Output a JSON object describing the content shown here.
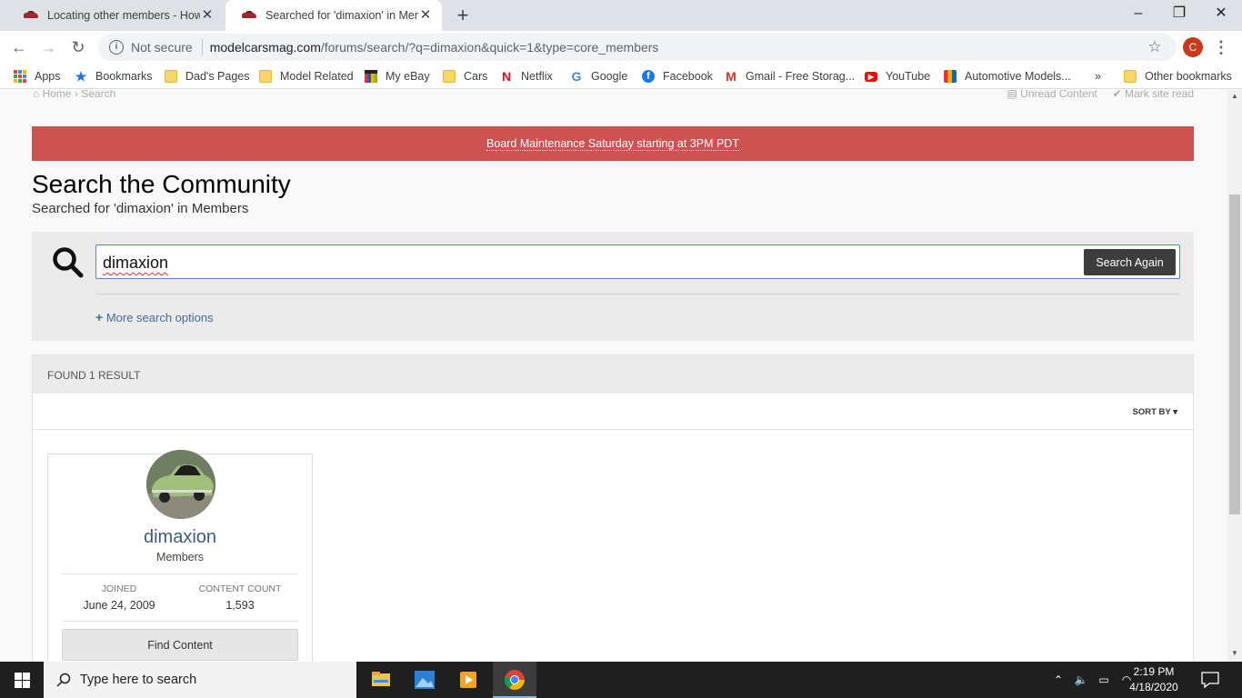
{
  "browser": {
    "tabs": [
      {
        "title": "Locating other members - How T",
        "active": false
      },
      {
        "title": "Searched for 'dimaxion' in Memb",
        "active": true
      }
    ],
    "new_tab": "+",
    "window_controls": {
      "minimize": "–",
      "restore": "❐",
      "close": "✕"
    },
    "omnibox": {
      "security_label": "Not secure",
      "url_host": "modelcarsmag.com",
      "url_path": "/forums/search/?q=dimaxion&quick=1&type=core_members"
    },
    "profile_initial": "C",
    "bookmarks": [
      {
        "label": "Apps",
        "icon": "apps-icon"
      },
      {
        "label": "Bookmarks",
        "icon": "star-icon"
      },
      {
        "label": "Dad's Pages",
        "icon": "folder-icon"
      },
      {
        "label": "Model Related",
        "icon": "folder-icon"
      },
      {
        "label": "My eBay",
        "icon": "ebay-icon"
      },
      {
        "label": "Cars",
        "icon": "folder-icon"
      },
      {
        "label": "Netflix",
        "icon": "netflix-icon"
      },
      {
        "label": "Google",
        "icon": "google-icon"
      },
      {
        "label": "Facebook",
        "icon": "facebook-icon"
      },
      {
        "label": "Gmail - Free Storag...",
        "icon": "gmail-icon"
      },
      {
        "label": "YouTube",
        "icon": "youtube-icon"
      },
      {
        "label": "Automotive Models...",
        "icon": "bag-icon"
      }
    ],
    "bookmarks_overflow": "»",
    "other_bookmarks": "Other bookmarks"
  },
  "page": {
    "breadcrumb": {
      "home": "Home",
      "separator": "›",
      "current": "Search"
    },
    "unread_content": "Unread Content",
    "mark_site_read": "Mark site read",
    "banner": "Board Maintenance Saturday starting at 3PM PDT",
    "title": "Search the Community",
    "subtitle": "Searched for 'dimaxion' in Members",
    "search": {
      "value": "dimaxion",
      "button_label": "Search Again",
      "more_options_label": "More search options"
    },
    "results": {
      "found_label": "Found 1 result",
      "sort_label": "SORT BY ▾",
      "members": [
        {
          "name": "dimaxion",
          "group": "Members",
          "joined_label": "Joined",
          "joined_value": "June 24, 2009",
          "content_count_label": "Content Count",
          "content_count_value": "1,593",
          "find_content_label": "Find Content"
        }
      ]
    }
  },
  "taskbar": {
    "search_placeholder": "Type here to search",
    "time": "2:19 PM",
    "date": "4/18/2020"
  },
  "colors": {
    "banner": "#cd5353",
    "link": "#3f5b85",
    "input_focus": "#4a86c9",
    "taskbar": "#1f1f1f"
  }
}
